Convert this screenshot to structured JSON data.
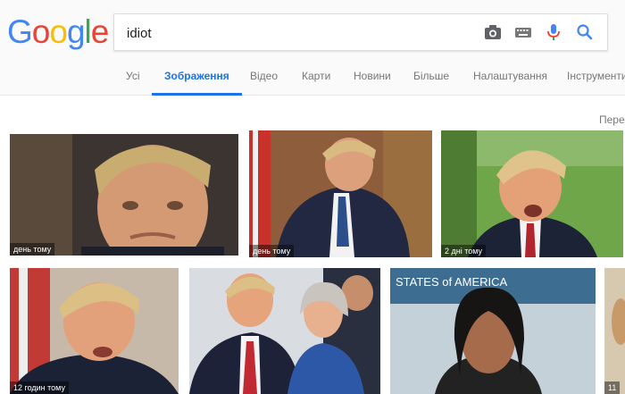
{
  "logo": {
    "letters": [
      "G",
      "o",
      "o",
      "g",
      "l",
      "e"
    ],
    "colors": [
      "#4285F4",
      "#EA4335",
      "#FBBC05",
      "#4285F4",
      "#34A853",
      "#EA4335"
    ]
  },
  "search": {
    "value": "idiot"
  },
  "icons": [
    "camera-icon",
    "keyboard-icon",
    "microphone-icon",
    "search-icon"
  ],
  "tabs": [
    {
      "label": "Усі",
      "active": false
    },
    {
      "label": "Зображення",
      "active": true
    },
    {
      "label": "Відео",
      "active": false
    },
    {
      "label": "Карти",
      "active": false
    },
    {
      "label": "Новини",
      "active": false
    },
    {
      "label": "Більше",
      "active": false
    },
    {
      "label": "Налаштування",
      "active": false
    },
    {
      "label": "Інструменти",
      "active": false
    }
  ],
  "perehid": "Пере",
  "results": [
    {
      "caption": "день тому"
    },
    {
      "caption": "день тому"
    },
    {
      "caption": "2 дні тому"
    },
    {
      "caption": ""
    },
    {
      "caption": "12 годин тому"
    },
    {
      "caption": ""
    },
    {
      "caption": ""
    },
    {
      "caption": "11"
    }
  ],
  "colors": {
    "accent": "#1a73e8"
  }
}
